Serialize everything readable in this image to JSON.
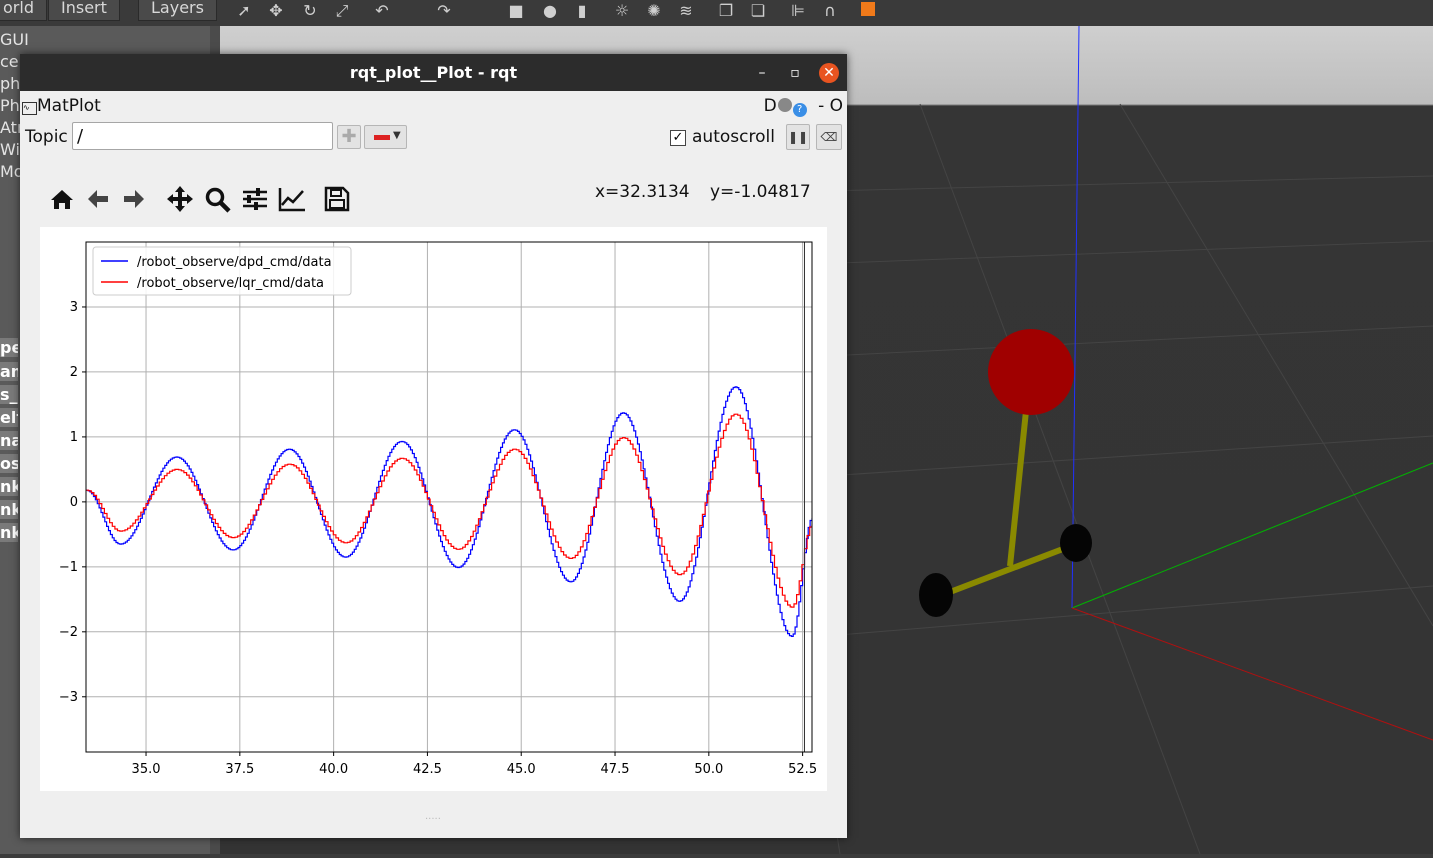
{
  "background_app": {
    "menus": [
      "orld",
      "Insert",
      "Layers"
    ],
    "left_panel_items": [
      "GUI",
      "ce",
      "ph",
      "Phy",
      "Atr",
      "Wir",
      "Mo"
    ],
    "left_panel_rows": [
      "pe",
      "am",
      "s_s",
      "elf",
      "na",
      "os",
      "nk",
      "nk",
      "nk"
    ]
  },
  "window": {
    "title": "rqt_plot__Plot - rqt",
    "min_icon": "minimize-icon",
    "max_icon": "maximize-icon",
    "close_icon": "close-icon"
  },
  "plugin": {
    "name": "MatPlot",
    "right_label": "D",
    "right_suffix": "- O"
  },
  "topic": {
    "label": "Topic",
    "value": "/"
  },
  "autoscroll": {
    "label": "autoscroll",
    "checked": true,
    "check_mark": "✓"
  },
  "toolbar": {
    "icons": [
      "home-icon",
      "back-icon",
      "forward-icon",
      "pan-icon",
      "zoom-icon",
      "configure-subplots-icon",
      "edit-axis-icon",
      "save-icon"
    ]
  },
  "coordinates": {
    "x": "x=32.3134",
    "y": "y=-1.04817"
  },
  "chart_data": {
    "type": "line",
    "title": "",
    "xlabel": "",
    "ylabel": "",
    "xlim": [
      33.4,
      52.75
    ],
    "ylim": [
      -3.85,
      4.0
    ],
    "xticks": [
      35.0,
      37.5,
      40.0,
      42.5,
      45.0,
      47.5,
      50.0,
      52.5
    ],
    "xtick_labels": [
      "35.0",
      "37.5",
      "40.0",
      "42.5",
      "45.0",
      "47.5",
      "50.0",
      "52.5"
    ],
    "yticks": [
      -3,
      -2,
      -1,
      0,
      1,
      2,
      3
    ],
    "ytick_labels": [
      "−3",
      "−2",
      "−1",
      "0",
      "1",
      "2",
      "3"
    ],
    "grid": true,
    "legend_position": "top-left",
    "series": [
      {
        "name": "/robot_observe/dpd_cmd/data",
        "color": "#0000ff",
        "x": [
          33.4,
          34.3,
          35.8,
          37.3,
          38.8,
          40.3,
          41.8,
          43.3,
          44.8,
          46.3,
          47.7,
          49.2,
          50.7,
          52.2,
          52.75
        ],
        "y": [
          0.18,
          -0.65,
          0.69,
          -0.74,
          0.81,
          -0.85,
          0.93,
          -1.01,
          1.11,
          -1.23,
          1.37,
          -1.53,
          1.77,
          -2.07,
          -0.25
        ]
      },
      {
        "name": "/robot_observe/lqr_cmd/data",
        "color": "#ff0000",
        "x": [
          33.4,
          34.3,
          35.8,
          37.3,
          38.8,
          40.3,
          41.8,
          43.3,
          44.8,
          46.3,
          47.7,
          49.2,
          50.7,
          52.2,
          52.75
        ],
        "y": [
          0.18,
          -0.45,
          0.5,
          -0.55,
          0.58,
          -0.63,
          0.67,
          -0.73,
          0.81,
          -0.87,
          0.99,
          -1.12,
          1.35,
          -1.62,
          -0.35
        ]
      }
    ]
  }
}
